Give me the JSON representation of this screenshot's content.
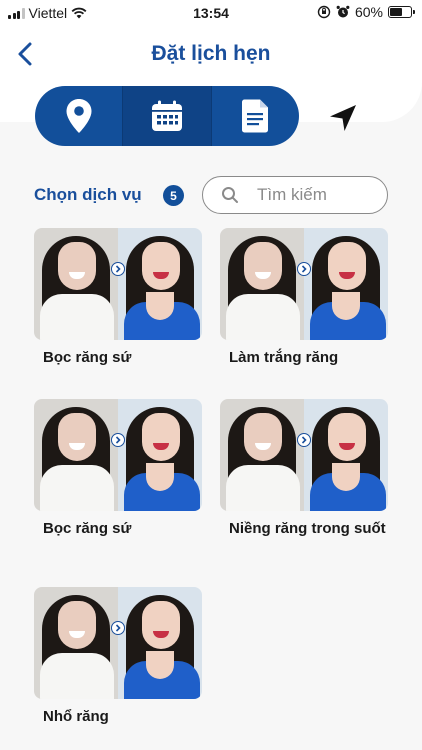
{
  "status_bar": {
    "carrier": "Viettel",
    "time": "13:54",
    "battery": "60%",
    "battery_level": 0.6
  },
  "header": {
    "title": "Đặt lịch hẹn"
  },
  "tabs": [
    {
      "icon": "location-pin-icon",
      "active": false
    },
    {
      "icon": "calendar-icon",
      "active": true
    },
    {
      "icon": "document-icon",
      "active": false
    }
  ],
  "nav_icon": "navigation-arrow-icon",
  "section": {
    "title": "Chọn dịch vụ",
    "count": "5"
  },
  "search": {
    "placeholder": "Tìm kiếm"
  },
  "services": [
    {
      "label": "Bọc răng sứ"
    },
    {
      "label": "Làm trắng răng"
    },
    {
      "label": "Bọc răng sứ"
    },
    {
      "label": "Niềng răng trong suốt"
    },
    {
      "label": "Nhổ răng"
    }
  ],
  "colors": {
    "primary": "#124f9a",
    "title": "#1a4f9c",
    "background": "#f7f7f7"
  }
}
